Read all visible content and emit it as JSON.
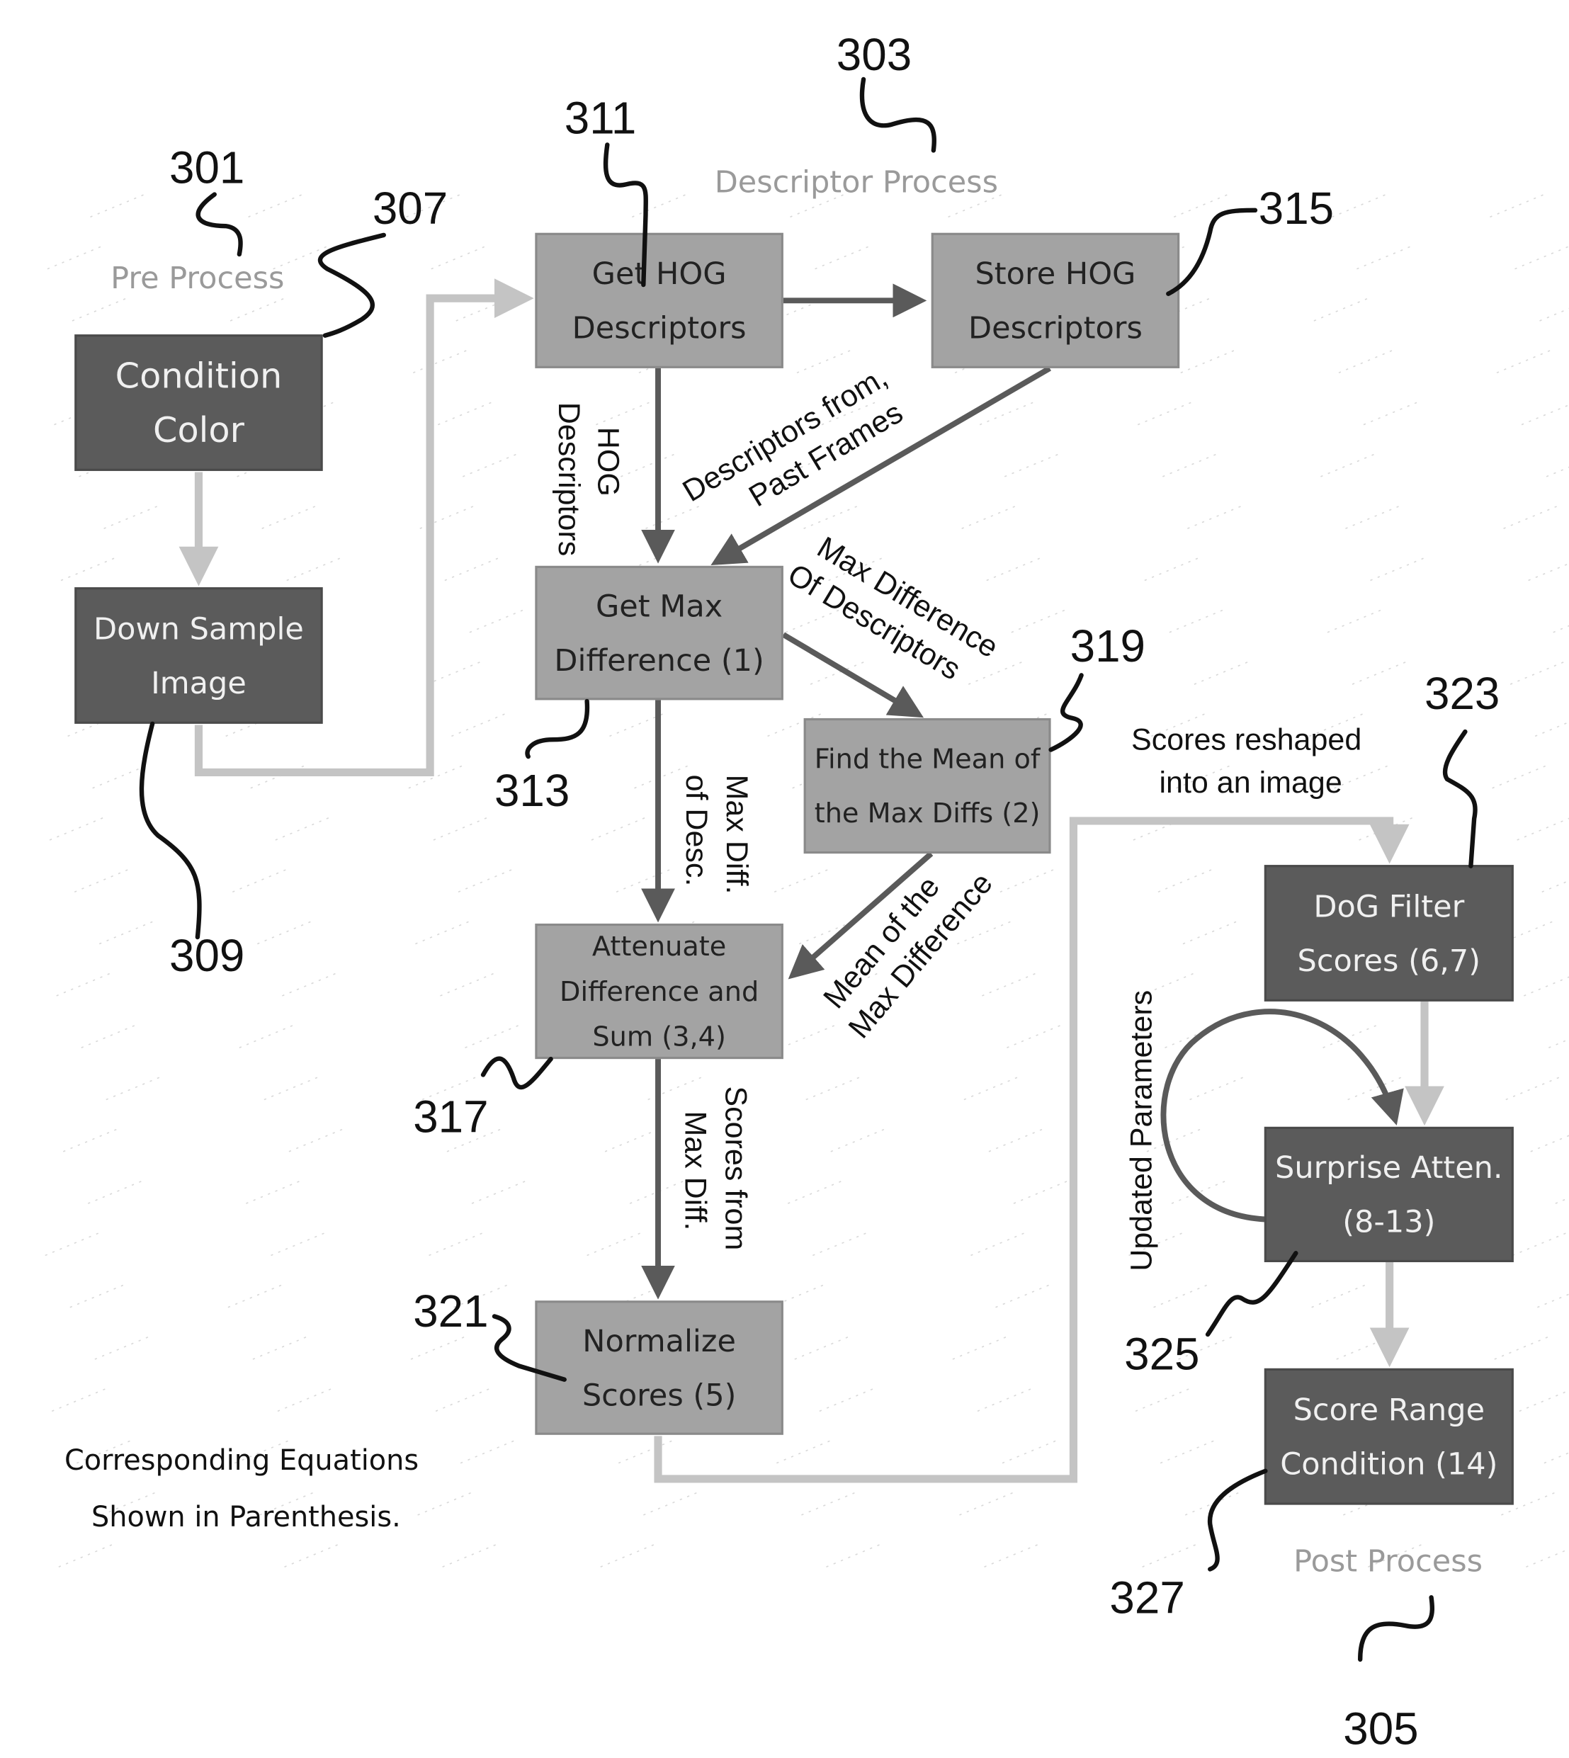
{
  "figure": {
    "sections": [
      {
        "id": "pre",
        "label": "Pre Process",
        "ref": "301"
      },
      {
        "id": "descriptor",
        "label": "Descriptor Process",
        "ref": "303"
      },
      {
        "id": "post",
        "label": "Post Process",
        "ref": "305"
      }
    ],
    "boxes": [
      {
        "id": "condition-color",
        "lines": [
          "Condition",
          "Color"
        ],
        "ref": "307",
        "style": "dark"
      },
      {
        "id": "down-sample-image",
        "lines": [
          "Down Sample",
          "Image"
        ],
        "ref": "309",
        "style": "dark"
      },
      {
        "id": "get-hog-descriptors",
        "lines": [
          "Get HOG",
          "Descriptors"
        ],
        "ref": "311",
        "style": "mid"
      },
      {
        "id": "store-hog-descriptors",
        "lines": [
          "Store HOG",
          "Descriptors"
        ],
        "ref": "315",
        "style": "mid"
      },
      {
        "id": "get-max-difference",
        "lines": [
          "Get Max",
          "Difference  (1)"
        ],
        "ref": "313",
        "style": "mid"
      },
      {
        "id": "find-mean-max-diffs",
        "lines": [
          "Find the Mean of",
          "the Max Diffs (2)"
        ],
        "ref": "319",
        "style": "mid"
      },
      {
        "id": "attenuate-difference-sum",
        "lines": [
          "Attenuate",
          "Difference and",
          "Sum (3,4)"
        ],
        "ref": "317",
        "style": "mid"
      },
      {
        "id": "normalize-scores",
        "lines": [
          "Normalize",
          "Scores (5)"
        ],
        "ref": "321",
        "style": "mid"
      },
      {
        "id": "dog-filter-scores",
        "lines": [
          "DoG Filter",
          "Scores (6,7)"
        ],
        "ref": "323",
        "style": "dark"
      },
      {
        "id": "surprise-atten",
        "lines": [
          "Surprise  Atten.",
          "(8-13)"
        ],
        "ref": "325",
        "style": "dark"
      },
      {
        "id": "score-range-condition",
        "lines": [
          "Score Range",
          "Condition (14)"
        ],
        "ref": "327",
        "style": "dark"
      }
    ],
    "edge_labels": {
      "hog_descriptors": [
        "HOG",
        "Descriptors"
      ],
      "descriptors_past_frames": [
        "Descriptors from,",
        "Past Frames"
      ],
      "max_difference_of_descriptors": [
        "Max Difference",
        "Of Descriptors"
      ],
      "max_diff_of_desc": [
        "Max Diff.",
        "of Desc."
      ],
      "mean_of_max_difference": [
        "Mean of the",
        "Max Difference"
      ],
      "scores_from_max_diff": [
        "Scores from",
        "Max Diff."
      ],
      "scores_reshaped": [
        "Scores reshaped",
        "into an image"
      ],
      "updated_parameters": [
        "Updated Parameters"
      ]
    },
    "footnote": [
      "Corresponding Equations",
      "Shown in Parenthesis."
    ]
  }
}
